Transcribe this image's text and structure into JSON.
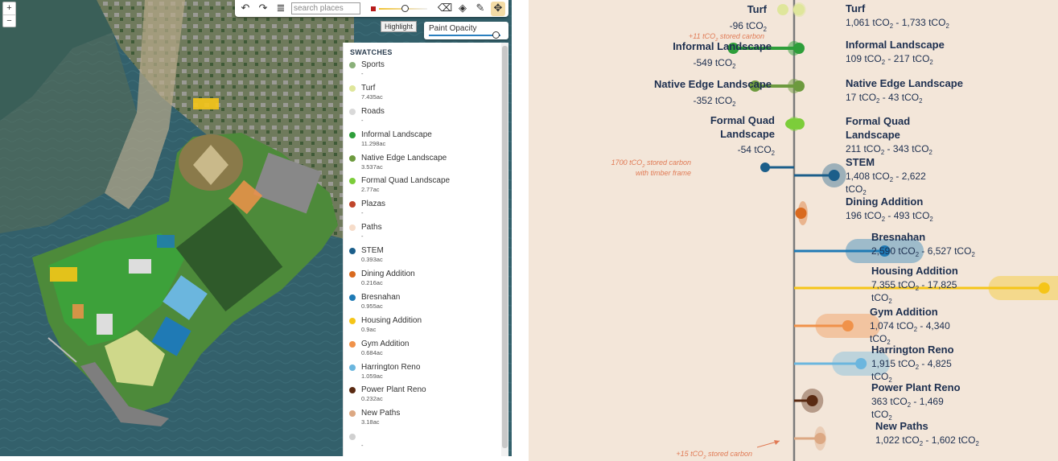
{
  "map": {
    "zoom_in": "+",
    "zoom_out": "−",
    "toolbar": {
      "undo_icon": "↶",
      "redo_icon": "↷",
      "layers_icon": "≣",
      "search_placeholder": "search places",
      "brush_color": "#b71c1c",
      "brush_size_fraction": 0.55,
      "eraser_icon": "⌫",
      "fill_icon": "◈",
      "pencil_icon": "✎",
      "move_icon": "✥"
    },
    "highlight_label": "Highlight",
    "paint_opacity": {
      "label": "Paint Opacity",
      "value_fraction": 0.95
    },
    "swatches": {
      "title": "SWATCHES",
      "items": [
        {
          "name": "Sports",
          "value": "-",
          "color": "#8ab07a"
        },
        {
          "name": "Turf",
          "value": "7.435ac",
          "color": "#dfe69b"
        },
        {
          "name": "Roads",
          "value": "-",
          "color": "#d9d9d9"
        },
        {
          "name": "Informal Landscape",
          "value": "11.298ac",
          "color": "#2e9e3a"
        },
        {
          "name": "Native Edge Landscape",
          "value": "3.537ac",
          "color": "#6d9a3e"
        },
        {
          "name": "Formal Quad Landscape",
          "value": "2.77ac",
          "color": "#7ccd3a"
        },
        {
          "name": "Plazas",
          "value": "-",
          "color": "#c0462b"
        },
        {
          "name": "Paths",
          "value": "-",
          "color": "#f6dcc9"
        },
        {
          "name": "STEM",
          "value": "0.393ac",
          "color": "#1b5e8a"
        },
        {
          "name": "Dining Addition",
          "value": "0.216ac",
          "color": "#d96a1f"
        },
        {
          "name": "Bresnahan",
          "value": "0.955ac",
          "color": "#1f7ab5"
        },
        {
          "name": "Housing Addition",
          "value": "0.9ac",
          "color": "#f5c518"
        },
        {
          "name": "Gym Addition",
          "value": "0.684ac",
          "color": "#f0924a"
        },
        {
          "name": "Harrington Reno",
          "value": "1.059ac",
          "color": "#6bb6de"
        },
        {
          "name": "Power Plant Reno",
          "value": "0.232ac",
          "color": "#5a2a12"
        },
        {
          "name": "New Paths",
          "value": "3.18ac",
          "color": "#dca883"
        },
        {
          "name": "",
          "value": "-",
          "color": "#d0d0d0"
        }
      ]
    }
  },
  "chart_data": {
    "type": "range-dot",
    "unit": "tCO2",
    "left_items": [
      {
        "name": "Turf",
        "value": "-96 tCO",
        "value_num": -96,
        "color": "#dfe69b"
      },
      {
        "name": "Informal Landscape",
        "value": "-549 tCO",
        "value_num": -549,
        "color": "#2e9e3a",
        "note": "+11 tCO stored carbon"
      },
      {
        "name": "Native Edge Landscape",
        "value": "-352 tCO",
        "value_num": -352,
        "color": "#6d9a3e"
      },
      {
        "name": "Formal Quad Landscape",
        "name_lines": [
          "Formal Quad",
          "Landscape"
        ],
        "value": "-54 tCO",
        "value_num": -54,
        "color": "#7ccd3a"
      },
      {
        "name": "STEM",
        "value_num": -1700,
        "color": "#1b5e8a",
        "note_lines": [
          "1700 tCO stored carbon",
          "with timber frame"
        ]
      }
    ],
    "right_items": [
      {
        "name": "Turf",
        "range": "1,061 tCO - 1,733 tCO",
        "min": 1061,
        "max": 1733,
        "color": "#dfe69b"
      },
      {
        "name": "Informal Landscape",
        "range": "109 tCO - 217 tCO",
        "min": 109,
        "max": 217,
        "color": "#2e9e3a"
      },
      {
        "name": "Native Edge Landscape",
        "range": "17 tCO - 43 tCO",
        "min": 17,
        "max": 43,
        "color": "#6d9a3e"
      },
      {
        "name": "Formal Quad Landscape",
        "name_lines": [
          "Formal Quad",
          "Landscape"
        ],
        "range": "211 tCO - 343 tCO",
        "min": 211,
        "max": 343,
        "color": "#7ccd3a"
      },
      {
        "name": "STEM",
        "range_lines": [
          "1,408 tCO - 2,622",
          "tCO"
        ],
        "min": 1408,
        "max": 2622,
        "color": "#1b5e8a"
      },
      {
        "name": "Dining Addition",
        "range": "196 tCO - 493 tCO",
        "min": 196,
        "max": 493,
        "color": "#d96a1f"
      },
      {
        "name": "Bresnahan",
        "range": "2,590 tCO - 6,527 tCO",
        "min": 2590,
        "max": 6527,
        "color": "#1f7ab5"
      },
      {
        "name": "Housing Addition",
        "range_lines": [
          "7,355 tCO - 17,825",
          "tCO"
        ],
        "min": 7355,
        "max": 17825,
        "color": "#f5c518"
      },
      {
        "name": "Gym Addition",
        "range_lines": [
          "1,074 tCO - 4,340",
          "tCO"
        ],
        "min": 1074,
        "max": 4340,
        "color": "#f0924a"
      },
      {
        "name": "Harrington Reno",
        "range_lines": [
          "1,915 tCO - 4,825",
          "tCO"
        ],
        "min": 1915,
        "max": 4825,
        "color": "#6bb6de"
      },
      {
        "name": "Power Plant Reno",
        "range_lines": [
          "363 tCO - 1,469",
          "tCO"
        ],
        "min": 363,
        "max": 1469,
        "color": "#5a2a12"
      },
      {
        "name": "New Paths",
        "range": "1,022 tCO - 1,602 tCO",
        "min": 1022,
        "max": 1602,
        "color": "#dca883"
      }
    ],
    "bottom_note": "+15 tCO stored carbon",
    "axis_color": "#7a7a7a",
    "note_color": "#e07a55"
  }
}
